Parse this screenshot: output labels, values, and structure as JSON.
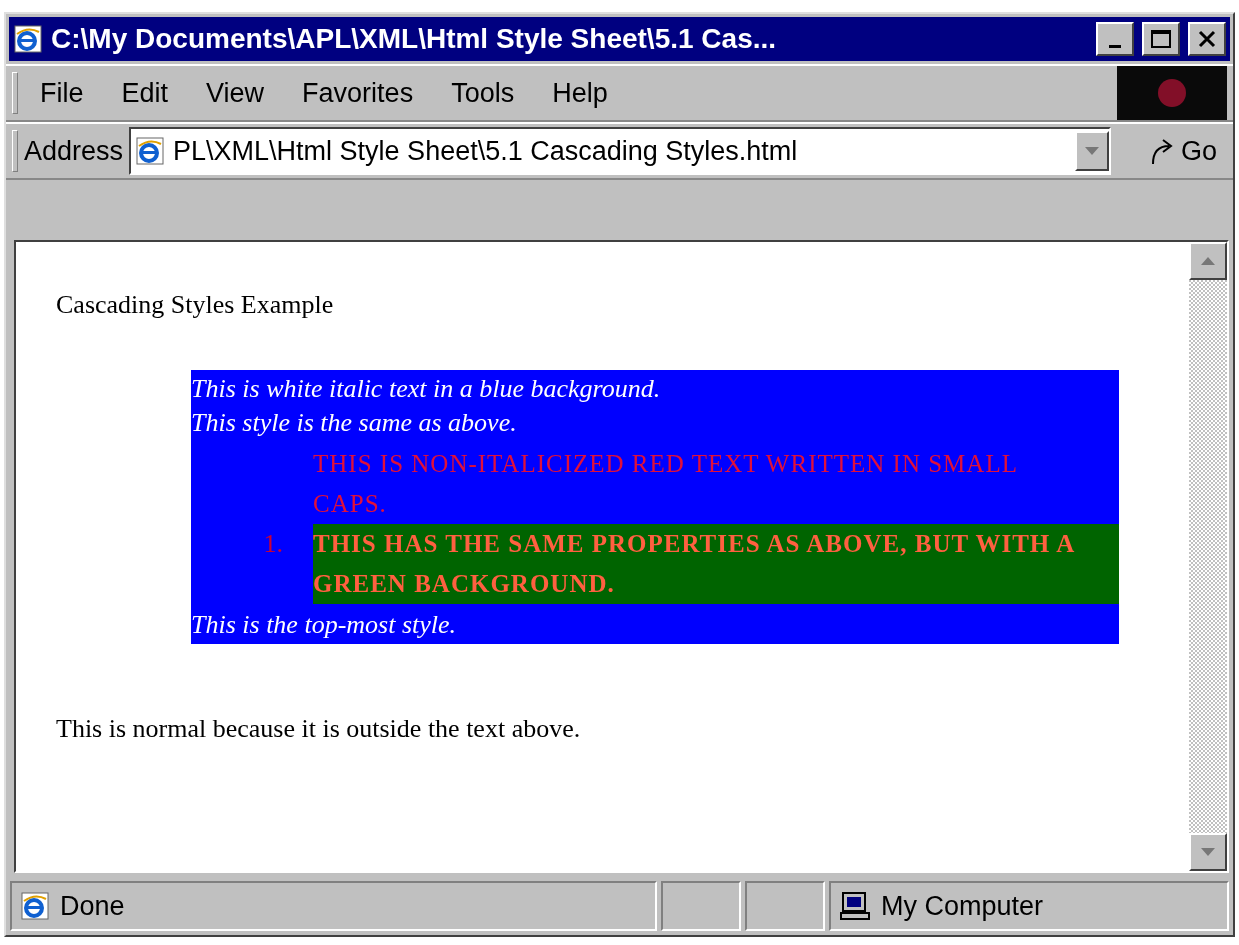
{
  "window": {
    "title": "C:\\My Documents\\APL\\XML\\Html Style Sheet\\5.1 Cas..."
  },
  "menu": [
    "File",
    "Edit",
    "View",
    "Favorites",
    "Tools",
    "Help"
  ],
  "address": {
    "label": "Address",
    "value": "PL\\XML\\Html Style Sheet\\5.1 Cascading Styles.html",
    "go": "Go"
  },
  "page": {
    "heading": "Cascading Styles Example",
    "box_lines_top": [
      "This is white italic text in a blue background.",
      "This style is the same as above."
    ],
    "list": [
      {
        "text": "THIS IS NON-ITALICIZED RED TEXT WRITTEN IN SMALL CAPS.",
        "highlighted": false
      },
      {
        "number": "1.",
        "text": "THIS HAS THE SAME PROPERTIES AS ABOVE, BUT WITH A GREEN BACKGROUND.",
        "highlighted": true
      }
    ],
    "box_lines_bottom": [
      "This is the top-most style."
    ],
    "footer_text": "This is normal because it is outside the text above."
  },
  "status_bar": {
    "status": "Done",
    "zone": "My Computer"
  }
}
